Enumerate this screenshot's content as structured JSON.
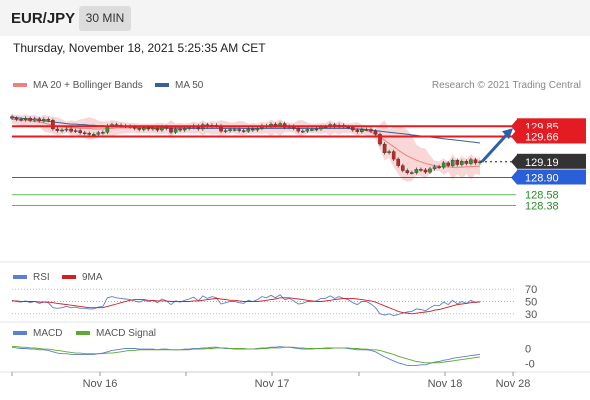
{
  "header": {
    "symbol": "EUR/JPY",
    "timeframe": "30 MIN",
    "datetime": "Thursday, November 18, 2021 5:25:35 AM CET"
  },
  "legend": {
    "ma20": "MA 20 + Bollinger Bands",
    "ma50": "MA 50",
    "credit": "Research © 2021 Trading Central"
  },
  "colors": {
    "resistance": "#e31b23",
    "support": "#2b5fd9",
    "pivot": "#222222",
    "target": "#5fb85f",
    "arrow": "#2e5fa8",
    "ma20": "#f08080",
    "ma50": "#3a5f9a",
    "band": "#f7c9c9",
    "candle_up": "#2a9a2a",
    "candle_down": "#d02020"
  },
  "chart_data": [
    {
      "type": "candlestick",
      "title": "",
      "x_ticks": [
        "Nov 16",
        "Nov 17",
        "Nov 18",
        "Nov 28"
      ],
      "ylim": [
        128.0,
        130.3
      ],
      "price_levels": [
        {
          "label": "129.85",
          "value": 129.85,
          "kind": "resistance"
        },
        {
          "label": "129.66",
          "value": 129.66,
          "kind": "resistance"
        },
        {
          "label": "129.19",
          "value": 129.19,
          "kind": "pivot"
        },
        {
          "label": "128.90",
          "value": 128.9,
          "kind": "support"
        },
        {
          "label": "128.58",
          "value": 128.58,
          "kind": "target"
        },
        {
          "label": "128.38",
          "value": 128.38,
          "kind": "target"
        }
      ],
      "close": [
        130.0,
        129.98,
        129.97,
        130.0,
        129.96,
        129.99,
        129.95,
        129.98,
        129.96,
        129.8,
        129.77,
        129.78,
        129.8,
        129.76,
        129.77,
        129.73,
        129.72,
        129.7,
        129.7,
        129.73,
        129.74,
        129.86,
        129.88,
        129.87,
        129.86,
        129.85,
        129.84,
        129.81,
        129.79,
        129.82,
        129.8,
        129.82,
        129.78,
        129.84,
        129.81,
        129.74,
        129.8,
        129.78,
        129.81,
        129.83,
        129.86,
        129.8,
        129.88,
        129.84,
        129.87,
        129.86,
        129.76,
        129.77,
        129.79,
        129.79,
        129.77,
        129.76,
        129.8,
        129.78,
        129.81,
        129.86,
        129.85,
        129.89,
        129.86,
        129.9,
        129.83,
        129.85,
        129.81,
        129.76,
        129.76,
        129.79,
        129.79,
        129.8,
        129.84,
        129.84,
        129.88,
        129.84,
        129.87,
        129.84,
        129.83,
        129.78,
        129.75,
        129.79,
        129.79,
        129.76,
        129.7,
        129.52,
        129.36,
        129.38,
        129.24,
        129.12,
        129.03,
        128.99,
        128.99,
        129.05,
        129.04,
        129.0,
        129.06,
        129.1,
        129.09,
        129.17,
        129.12,
        129.22,
        129.14,
        129.2,
        129.16,
        129.23,
        129.17,
        129.19
      ],
      "ma20": [
        129.98,
        129.97,
        129.96,
        129.96,
        129.95,
        129.94,
        129.93,
        129.91,
        129.89,
        129.87,
        129.85,
        129.84,
        129.83,
        129.82,
        129.82,
        129.81,
        129.81,
        129.81,
        129.8,
        129.8,
        129.8,
        129.81,
        129.81,
        129.82,
        129.82,
        129.82,
        129.82,
        129.82,
        129.81,
        129.81,
        129.81,
        129.81,
        129.81,
        129.81,
        129.81,
        129.81,
        129.81,
        129.81,
        129.81,
        129.82,
        129.82,
        129.82,
        129.82,
        129.82,
        129.82,
        129.82,
        129.82,
        129.82,
        129.82,
        129.82,
        129.82,
        129.81,
        129.81,
        129.81,
        129.81,
        129.82,
        129.82,
        129.82,
        129.83,
        129.83,
        129.83,
        129.83,
        129.82,
        129.82,
        129.82,
        129.82,
        129.81,
        129.81,
        129.81,
        129.82,
        129.82,
        129.82,
        129.82,
        129.82,
        129.81,
        129.81,
        129.8,
        129.79,
        129.77,
        129.74,
        129.7,
        129.65,
        129.59,
        129.53,
        129.47,
        129.41,
        129.35,
        129.3,
        129.26,
        129.22,
        129.19,
        129.16,
        129.14,
        129.12,
        129.11,
        129.1,
        129.1,
        129.09,
        129.09,
        129.09,
        129.1,
        129.1,
        129.11,
        129.11
      ],
      "ma50": [
        130.02,
        130.01,
        130.0,
        129.99,
        129.98,
        129.97,
        129.96,
        129.95,
        129.94,
        129.93,
        129.92,
        129.91,
        129.9,
        129.89,
        129.89,
        129.88,
        129.88,
        129.87,
        129.87,
        129.86,
        129.86,
        129.85,
        129.85,
        129.85,
        129.84,
        129.84,
        129.84,
        129.83,
        129.83,
        129.83,
        129.83,
        129.82,
        129.82,
        129.82,
        129.82,
        129.82,
        129.82,
        129.82,
        129.82,
        129.81,
        129.81,
        129.81,
        129.81,
        129.81,
        129.81,
        129.81,
        129.81,
        129.81,
        129.81,
        129.81,
        129.81,
        129.81,
        129.81,
        129.81,
        129.81,
        129.81,
        129.81,
        129.81,
        129.81,
        129.81,
        129.81,
        129.81,
        129.81,
        129.81,
        129.81,
        129.81,
        129.81,
        129.81,
        129.81,
        129.81,
        129.81,
        129.81,
        129.81,
        129.81,
        129.81,
        129.8,
        129.8,
        129.8,
        129.79,
        129.78,
        129.77,
        129.76,
        129.75,
        129.74,
        129.73,
        129.72,
        129.71,
        129.7,
        129.69,
        129.68,
        129.67,
        129.66,
        129.65,
        129.64,
        129.63,
        129.62,
        129.61,
        129.6,
        129.59,
        129.58,
        129.57,
        129.56,
        129.55,
        129.54
      ],
      "forecast_arrow": {
        "from": 129.19,
        "to": 129.85
      }
    },
    {
      "type": "line",
      "title": "",
      "series": [
        {
          "name": "RSI",
          "values": [
            52,
            50,
            49,
            51,
            48,
            50,
            47,
            49,
            48,
            40,
            39,
            40,
            42,
            40,
            41,
            39,
            39,
            38,
            38,
            41,
            42,
            56,
            58,
            56,
            55,
            54,
            53,
            51,
            49,
            52,
            50,
            52,
            48,
            54,
            51,
            45,
            51,
            49,
            52,
            54,
            57,
            51,
            59,
            55,
            58,
            56,
            46,
            48,
            50,
            50,
            48,
            47,
            52,
            50,
            53,
            58,
            56,
            60,
            56,
            61,
            53,
            55,
            51,
            46,
            47,
            50,
            50,
            51,
            55,
            55,
            59,
            55,
            58,
            55,
            53,
            48,
            45,
            50,
            50,
            46,
            40,
            30,
            28,
            30,
            27,
            29,
            31,
            33,
            34,
            38,
            37,
            35,
            40,
            44,
            43,
            49,
            45,
            52,
            46,
            50,
            47,
            52,
            48,
            50
          ]
        },
        {
          "name": "9MA",
          "values": [
            51,
            51,
            50,
            50,
            50,
            50,
            49,
            49,
            49,
            48,
            47,
            46,
            45,
            44,
            43,
            42,
            41,
            40,
            40,
            40,
            40,
            42,
            44,
            46,
            48,
            50,
            52,
            53,
            53,
            53,
            52,
            52,
            51,
            51,
            51,
            50,
            50,
            50,
            50,
            50,
            51,
            51,
            52,
            53,
            54,
            55,
            54,
            53,
            52,
            52,
            51,
            50,
            50,
            50,
            50,
            51,
            52,
            53,
            54,
            56,
            56,
            56,
            55,
            54,
            53,
            52,
            51,
            50,
            50,
            51,
            52,
            53,
            54,
            55,
            55,
            55,
            54,
            53,
            52,
            51,
            49,
            46,
            43,
            40,
            37,
            34,
            32,
            31,
            30,
            31,
            32,
            33,
            34,
            36,
            37,
            39,
            41,
            43,
            45,
            46,
            47,
            48,
            49,
            49
          ]
        }
      ],
      "reference_lines": [
        70,
        50,
        30
      ],
      "tick_labels": [
        "70",
        "50",
        "30"
      ],
      "ylim": [
        20,
        80
      ]
    },
    {
      "type": "line",
      "title": "",
      "series": [
        {
          "name": "MACD",
          "values": [
            0.02,
            0.01,
            0.0,
            0.0,
            -0.01,
            -0.01,
            -0.02,
            -0.02,
            -0.03,
            -0.05,
            -0.07,
            -0.08,
            -0.08,
            -0.09,
            -0.09,
            -0.09,
            -0.09,
            -0.09,
            -0.09,
            -0.08,
            -0.07,
            -0.05,
            -0.03,
            -0.02,
            -0.01,
            0.0,
            0.0,
            0.0,
            -0.01,
            -0.01,
            -0.01,
            -0.01,
            -0.02,
            -0.01,
            -0.01,
            -0.02,
            -0.02,
            -0.02,
            -0.01,
            -0.01,
            0.0,
            0.0,
            0.01,
            0.01,
            0.02,
            0.02,
            0.01,
            0.0,
            0.0,
            -0.01,
            -0.01,
            -0.01,
            -0.01,
            -0.01,
            0.0,
            0.01,
            0.01,
            0.02,
            0.02,
            0.03,
            0.02,
            0.02,
            0.01,
            0.0,
            -0.01,
            -0.01,
            -0.01,
            0.0,
            0.0,
            0.01,
            0.01,
            0.01,
            0.01,
            0.01,
            0.0,
            -0.01,
            -0.02,
            -0.02,
            -0.02,
            -0.03,
            -0.05,
            -0.09,
            -0.13,
            -0.16,
            -0.19,
            -0.22,
            -0.24,
            -0.26,
            -0.26,
            -0.26,
            -0.25,
            -0.25,
            -0.23,
            -0.21,
            -0.2,
            -0.18,
            -0.17,
            -0.15,
            -0.14,
            -0.13,
            -0.12,
            -0.11,
            -0.1,
            -0.09
          ]
        },
        {
          "name": "MACD Signal",
          "values": [
            0.03,
            0.03,
            0.02,
            0.02,
            0.01,
            0.01,
            0.0,
            -0.01,
            -0.01,
            -0.02,
            -0.03,
            -0.04,
            -0.05,
            -0.06,
            -0.07,
            -0.07,
            -0.08,
            -0.08,
            -0.08,
            -0.08,
            -0.08,
            -0.07,
            -0.07,
            -0.06,
            -0.05,
            -0.04,
            -0.03,
            -0.03,
            -0.02,
            -0.02,
            -0.02,
            -0.02,
            -0.02,
            -0.02,
            -0.02,
            -0.02,
            -0.02,
            -0.02,
            -0.02,
            -0.02,
            -0.01,
            -0.01,
            -0.01,
            0.0,
            0.0,
            0.01,
            0.01,
            0.01,
            0.0,
            0.0,
            0.0,
            0.0,
            -0.01,
            -0.01,
            -0.01,
            0.0,
            0.0,
            0.01,
            0.01,
            0.01,
            0.02,
            0.02,
            0.02,
            0.01,
            0.01,
            0.0,
            0.0,
            0.0,
            0.0,
            0.0,
            0.0,
            0.01,
            0.01,
            0.01,
            0.01,
            0.0,
            0.0,
            -0.01,
            -0.01,
            -0.02,
            -0.02,
            -0.03,
            -0.05,
            -0.07,
            -0.09,
            -0.12,
            -0.14,
            -0.16,
            -0.18,
            -0.2,
            -0.21,
            -0.22,
            -0.22,
            -0.22,
            -0.22,
            -0.21,
            -0.2,
            -0.19,
            -0.18,
            -0.17,
            -0.16,
            -0.15,
            -0.14,
            -0.13
          ]
        }
      ],
      "tick_labels": [
        "0",
        "-0"
      ],
      "ylim": [
        -0.3,
        0.1
      ]
    }
  ]
}
